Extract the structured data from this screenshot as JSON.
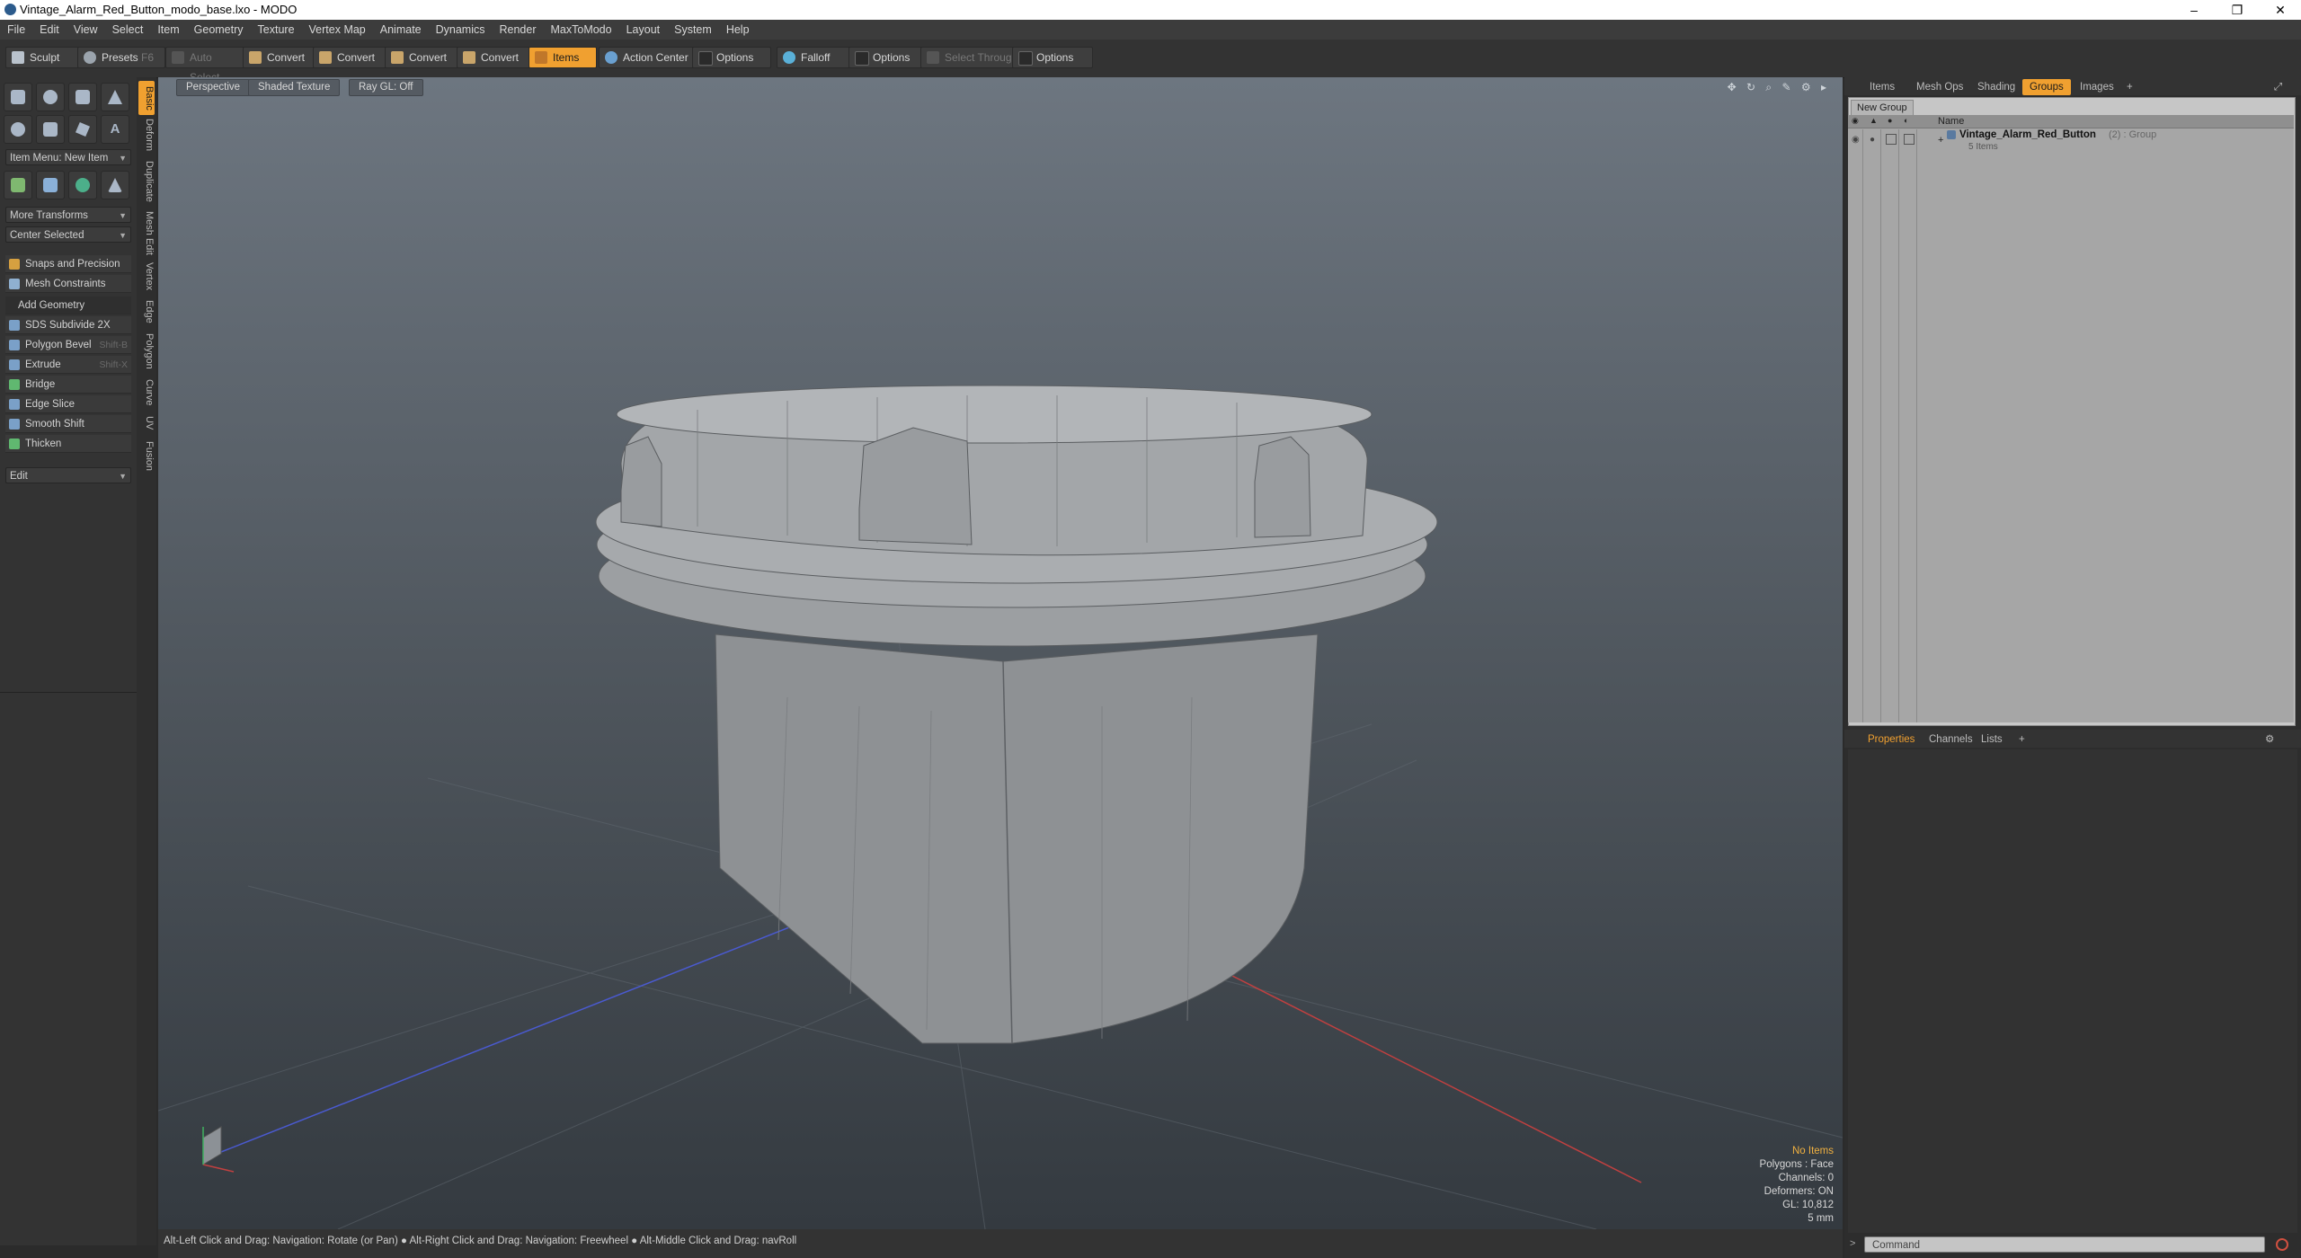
{
  "window": {
    "title": "Vintage_Alarm_Red_Button_modo_base.lxo - MODO",
    "minimize": "–",
    "maximize": "❐",
    "close": "✕"
  },
  "menu": [
    "File",
    "Edit",
    "View",
    "Select",
    "Item",
    "Geometry",
    "Texture",
    "Vertex Map",
    "Animate",
    "Dynamics",
    "Render",
    "MaxToModo",
    "Layout",
    "System",
    "Help"
  ],
  "toolbar": {
    "sculpt": "Sculpt",
    "presets": "Presets",
    "presets_key": "F6",
    "auto_select": "Auto Select",
    "convert1": "Convert",
    "convert2": "Convert",
    "convert3": "Convert",
    "convert4": "Convert",
    "items": "Items",
    "action_center": "Action Center",
    "options1": "Options",
    "falloff": "Falloff",
    "options2": "Options",
    "select_through": "Select Through",
    "options3": "Options"
  },
  "left_panel": {
    "item_menu": "Item Menu: New Item",
    "more_transforms": "More Transforms",
    "center_selected": "Center Selected",
    "snaps": "Snaps and Precision",
    "mesh_constraints": "Mesh Constraints",
    "add_geometry": "Add Geometry",
    "tools": [
      {
        "label": "SDS Subdivide 2X",
        "shortcut": ""
      },
      {
        "label": "Polygon Bevel",
        "shortcut": "Shift-B"
      },
      {
        "label": "Extrude",
        "shortcut": "Shift-X"
      },
      {
        "label": "Bridge",
        "shortcut": ""
      },
      {
        "label": "Edge Slice",
        "shortcut": ""
      },
      {
        "label": "Smooth Shift",
        "shortcut": ""
      },
      {
        "label": "Thicken",
        "shortcut": ""
      }
    ],
    "edit": "Edit",
    "vtabs": [
      "Basic",
      "Deform",
      "Duplicate",
      "Mesh Edit",
      "Vertex",
      "Edge",
      "Polygon",
      "Curve",
      "UV",
      "Fusion"
    ]
  },
  "viewport": {
    "perspective": "Perspective",
    "shading": "Shaded Texture",
    "raygl": "Ray GL: Off",
    "info": {
      "no_items": "No Items",
      "polygons": "Polygons : Face",
      "channels": "Channels: 0",
      "deformers": "Deformers: ON",
      "gl": "GL: 10,812",
      "unit": "5 mm"
    }
  },
  "status_bar": "Alt-Left Click and Drag: Navigation: Rotate (or Pan) ●  Alt-Right Click and Drag: Navigation: Freewheel ●  Alt-Middle Click and Drag: navRoll",
  "right_panel": {
    "tabs": [
      "Items",
      "Mesh Ops",
      "Shading",
      "Groups",
      "Images"
    ],
    "new_group": "New Group",
    "name_header": "Name",
    "group_name": "Vintage_Alarm_Red_Button",
    "group_suffix": "(2) : Group",
    "group_count": "5 Items",
    "prop_tabs": [
      "Properties",
      "Channels",
      "Lists"
    ],
    "command_placeholder": "Command"
  },
  "colors": {
    "accent": "#f0a030"
  }
}
